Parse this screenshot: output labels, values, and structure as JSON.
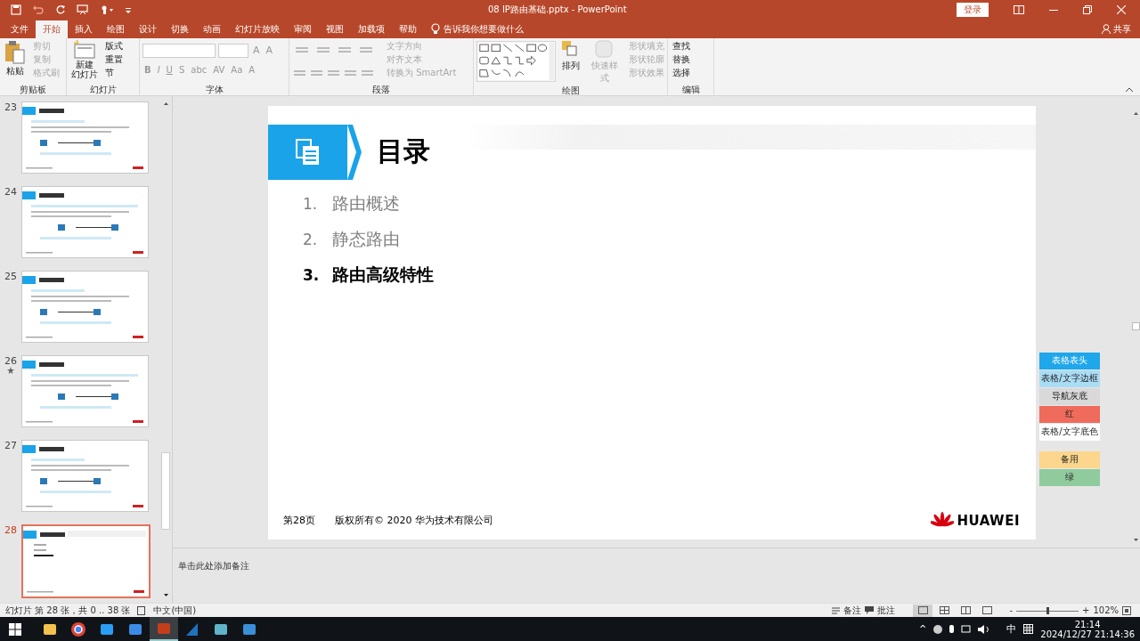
{
  "window": {
    "title": "08 IP路由基础.pptx  -  PowerPoint",
    "login": "登录",
    "share": "共享"
  },
  "menu_tabs": [
    {
      "label": "文件",
      "selected": false
    },
    {
      "label": "开始",
      "selected": true
    },
    {
      "label": "插入",
      "selected": false
    },
    {
      "label": "绘图",
      "selected": false
    },
    {
      "label": "设计",
      "selected": false
    },
    {
      "label": "切换",
      "selected": false
    },
    {
      "label": "动画",
      "selected": false
    },
    {
      "label": "幻灯片放映",
      "selected": false
    },
    {
      "label": "审阅",
      "selected": false
    },
    {
      "label": "视图",
      "selected": false
    },
    {
      "label": "加载项",
      "selected": false
    },
    {
      "label": "帮助",
      "selected": false
    }
  ],
  "tell_me": "告诉我你想要做什么",
  "ribbon": {
    "clipboard": {
      "label": "剪贴板",
      "large": "粘贴",
      "items": [
        {
          "label": "剪切",
          "disabled": true
        },
        {
          "label": "复制",
          "disabled": true
        },
        {
          "label": "格式刷",
          "disabled": true
        }
      ]
    },
    "slides": {
      "label": "幻灯片",
      "large": [
        "新建",
        "幻灯片"
      ],
      "items": [
        {
          "label": "版式",
          "disabled": false
        },
        {
          "label": "重置",
          "disabled": false
        },
        {
          "label": "节",
          "disabled": false
        }
      ]
    },
    "font": {
      "label": "字体",
      "size_buttons": [
        "A",
        "A"
      ],
      "format_buttons": [
        "B",
        "I",
        "U",
        "S",
        "abc",
        "AV",
        "Aa",
        "A"
      ]
    },
    "paragraph": {
      "label": "段落",
      "items": [
        {
          "label": "文字方向",
          "disabled": true
        },
        {
          "label": "对齐文本",
          "disabled": true
        },
        {
          "label": "转换为 SmartArt",
          "disabled": true
        }
      ]
    },
    "drawing": {
      "label": "绘图",
      "arrange": "排列",
      "quick_styles": "快速样式",
      "items": [
        {
          "label": "形状填充",
          "disabled": true
        },
        {
          "label": "形状轮廓",
          "disabled": true
        },
        {
          "label": "形状效果",
          "disabled": true
        }
      ]
    },
    "editing": {
      "label": "编辑",
      "items": [
        {
          "label": "查找",
          "disabled": false
        },
        {
          "label": "替换",
          "disabled": false
        },
        {
          "label": "选择",
          "disabled": false
        }
      ]
    }
  },
  "thumbnails": [
    {
      "number": "23",
      "selected": false,
      "animated": false
    },
    {
      "number": "24",
      "selected": false,
      "animated": false
    },
    {
      "number": "25",
      "selected": false,
      "animated": false
    },
    {
      "number": "26",
      "selected": false,
      "animated": true
    },
    {
      "number": "27",
      "selected": false,
      "animated": false
    },
    {
      "number": "28",
      "selected": true,
      "animated": false
    }
  ],
  "slide": {
    "title": "目录",
    "items": [
      {
        "number": "1.",
        "text": "路由概述",
        "current": false
      },
      {
        "number": "2.",
        "text": "静态路由",
        "current": false
      },
      {
        "number": "3.",
        "text": "路由高级特性",
        "current": true
      }
    ],
    "page": "第28页",
    "copyright": "版权所有© 2020 华为技术有限公司",
    "logo": "HUAWEI"
  },
  "swatches": [
    {
      "label": "表格表头",
      "color": "#1ea7ea"
    },
    {
      "label": "表格/文字边框",
      "color": "#aadcf4"
    },
    {
      "label": "导航灰底",
      "color": "#d9d9d9"
    },
    {
      "label": "红",
      "color": "#ef6b5c"
    },
    {
      "label": "表格/文字底色",
      "color": "#ffffff"
    }
  ],
  "spare_swatches": [
    {
      "label": "备用",
      "color": "#fbd68c"
    },
    {
      "label": "绿",
      "color": "#8fcb9d"
    }
  ],
  "notes": {
    "placeholder": "单击此处添加备注"
  },
  "status_bar": {
    "slide_info": "幻灯片 第 28 张，共 0 .. 38 张",
    "language": "中文(中国)",
    "notes": "备注",
    "comments": "批注",
    "views": [
      {
        "selected": true
      },
      {
        "selected": false
      },
      {
        "selected": false
      },
      {
        "selected": false
      }
    ],
    "zoom_minus": "-",
    "zoom_plus": "+",
    "zoom": {
      "level": 0.5
    },
    "zoom_text": "102%"
  },
  "taskbar": {
    "apps": [
      {
        "selected": false
      },
      {
        "selected": false
      },
      {
        "selected": false
      },
      {
        "selected": false
      },
      {
        "selected": true
      },
      {
        "selected": false
      },
      {
        "selected": false
      },
      {
        "selected": false
      }
    ],
    "tray_caret": "^",
    "ime": "中",
    "time": "21:14",
    "date": "2024/12/27 21:14:36"
  }
}
